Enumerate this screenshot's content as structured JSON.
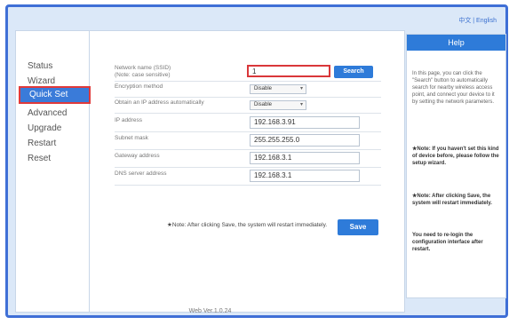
{
  "lang_label": "中文 | English",
  "sidebar": {
    "items": [
      {
        "label": "Status"
      },
      {
        "label": "Wizard"
      },
      {
        "label": "Quick Set"
      },
      {
        "label": "Advanced"
      },
      {
        "label": "Upgrade"
      },
      {
        "label": "Restart"
      },
      {
        "label": "Reset"
      }
    ]
  },
  "form": {
    "ssid_label_1": "Network name (SSID)",
    "ssid_label_2": "(Note: case sensitive)",
    "ssid_value": "1",
    "search_label": "Search",
    "encryption_label": "Encryption method",
    "encryption_value": "Disable",
    "auto_ip_label": "Obtain an IP address automatically",
    "auto_ip_value": "Disable",
    "ip_label": "IP address",
    "ip_value": "192.168.3.91",
    "subnet_label": "Subnet mask",
    "subnet_value": "255.255.255.0",
    "gateway_label": "Gateway address",
    "gateway_value": "192.168.3.1",
    "dns_label": "DNS server address",
    "dns_value": "192.168.3.1",
    "note": "★Note: After clicking Save, the system will restart immediately.",
    "save_label": "Save"
  },
  "footer": {
    "version": "Web Ver.1.0.24"
  },
  "help": {
    "title": "Help",
    "para1": "In this page, you can click the \"Search\" button to automatically search for nearby wireless access point, and connect your device to it by setting the network parameters.",
    "para2": "★Note: If you haven't set this kind of device before, please follow the setup wizard.",
    "para3": "★Note: After clicking Save, the system will restart immediately.",
    "para4": "You need to re-login the configuration interface after restart."
  }
}
